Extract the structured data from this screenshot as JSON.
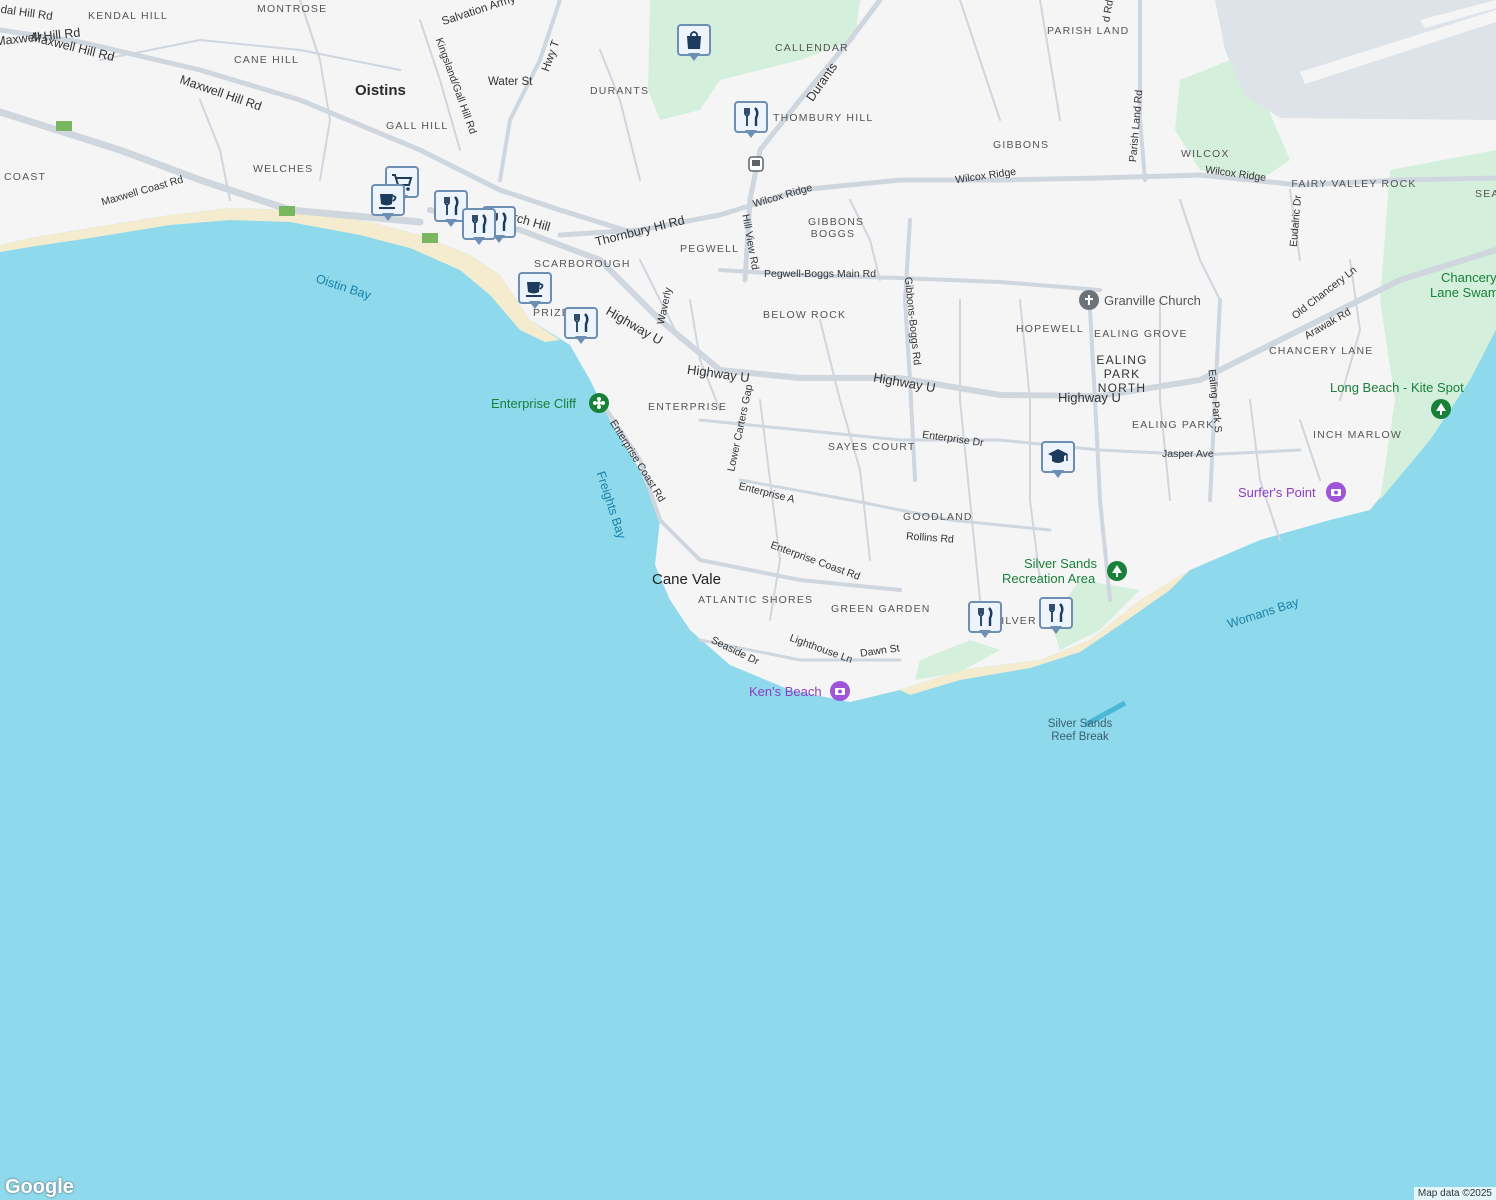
{
  "map": {
    "towns": [
      {
        "id": "oistins",
        "text": "Oistins"
      },
      {
        "id": "cane-vale",
        "text": "Cane Vale"
      }
    ],
    "areas": [
      {
        "id": "kendal-hill",
        "text": "KENDAL HILL"
      },
      {
        "id": "montrose",
        "text": "MONTROSE"
      },
      {
        "id": "cane-hill",
        "text": "CANE HILL"
      },
      {
        "id": "callendar",
        "text": "CALLENDAR"
      },
      {
        "id": "parish-land",
        "text": "PARISH LAND"
      },
      {
        "id": "durants",
        "text": "DURANTS"
      },
      {
        "id": "gall-hill",
        "text": "GALL HILL"
      },
      {
        "id": "thombury-hill",
        "text": "THOMBURY HILL"
      },
      {
        "id": "welches",
        "text": "WELCHES"
      },
      {
        "id": "coast",
        "text": "COAST"
      },
      {
        "id": "gibbons",
        "text": "GIBBONS"
      },
      {
        "id": "wilcox",
        "text": "WILCOX"
      },
      {
        "id": "fairy-valley-rock",
        "text": "FAIRY VALLEY ROCK"
      },
      {
        "id": "gibbons-boggs",
        "text": "GIBBONS BOGGS"
      },
      {
        "id": "pegwell",
        "text": "PEGWELL"
      },
      {
        "id": "scarborough",
        "text": "SCARBOROUGH"
      },
      {
        "id": "below-rock",
        "text": "BELOW ROCK"
      },
      {
        "id": "hopewell",
        "text": "HOPEWELL"
      },
      {
        "id": "ealing-grove",
        "text": "EALING GROVE"
      },
      {
        "id": "chancery-lane",
        "text": "CHANCERY LANE"
      },
      {
        "id": "ealing-park-north",
        "text": "EALING PARK NORTH"
      },
      {
        "id": "enterprise",
        "text": "ENTERPRISE"
      },
      {
        "id": "sayes-court",
        "text": "SAYES COURT"
      },
      {
        "id": "ealing-park",
        "text": "EALING PARK"
      },
      {
        "id": "inch-marlow",
        "text": "INCH MARLOW"
      },
      {
        "id": "goodland",
        "text": "GOODLAND"
      },
      {
        "id": "atlantic-shores",
        "text": "ATLANTIC SHORES"
      },
      {
        "id": "green-garden",
        "text": "GREEN GARDEN"
      },
      {
        "id": "prize",
        "text": "PRIZE"
      },
      {
        "id": "silver-sands",
        "text": "SILVER S"
      },
      {
        "id": "sea",
        "text": "SEA"
      }
    ],
    "roads": [
      {
        "id": "kendal-hill-rd",
        "text": "Kendal Hill Rd"
      },
      {
        "id": "maxwell-hill-rd-1",
        "text": "Maxwell Hill Rd"
      },
      {
        "id": "maxwell-hill-rd-2",
        "text": "Maxwell Hill Rd"
      },
      {
        "id": "maxwell-hill-rd-3",
        "text": "Maxwell Hill Rd"
      },
      {
        "id": "salvation-army-dr",
        "text": "Salvation Army Dr"
      },
      {
        "id": "kingsland-gall-hill-rd",
        "text": "Kingsland/Gall Hill Rd"
      },
      {
        "id": "hwy-t",
        "text": "Hwy T"
      },
      {
        "id": "water-st",
        "text": "Water St"
      },
      {
        "id": "durants-rd",
        "text": "Durants"
      },
      {
        "id": "maxwell-coast-rd",
        "text": "Maxwell Coast Rd"
      },
      {
        "id": "church-hill",
        "text": "Church Hill"
      },
      {
        "id": "thornbury-hl-rd",
        "text": "Thornbury Hl Rd"
      },
      {
        "id": "wilcox-ridge-1",
        "text": "Wilcox Ridge"
      },
      {
        "id": "wilcox-ridge-2",
        "text": "Wilcox Ridge"
      },
      {
        "id": "wilcox-ridge-3",
        "text": "Wilcox Ridge"
      },
      {
        "id": "hill-view-rd",
        "text": "Hill View Rd"
      },
      {
        "id": "parish-land-rd",
        "text": "Parish Land Rd"
      },
      {
        "id": "eudalric-dr",
        "text": "Eudalric Dr"
      },
      {
        "id": "pegwell-boggs-main-rd",
        "text": "Pegwell-Boggs Main Rd"
      },
      {
        "id": "gibbons-boggs-rd",
        "text": "Gibbons-Boggs Rd"
      },
      {
        "id": "waverly",
        "text": "Waverly"
      },
      {
        "id": "old-chancery-ln",
        "text": "Old Chancery Ln"
      },
      {
        "id": "arawak-rd",
        "text": "Arawak Rd"
      },
      {
        "id": "ealing-park-s",
        "text": "Ealing Park S"
      },
      {
        "id": "lower-carters-gap",
        "text": "Lower Carters Gap"
      },
      {
        "id": "enterprise-dr",
        "text": "Enterprise Dr"
      },
      {
        "id": "jasper-ave",
        "text": "Jasper Ave"
      },
      {
        "id": "enterprise-coast-rd-1",
        "text": "Enterprise Coast Rd"
      },
      {
        "id": "enterprise-coast-rd-2",
        "text": "Enterprise Coast Rd"
      },
      {
        "id": "enterprise-a",
        "text": "Enterprise A"
      },
      {
        "id": "rollins-rd",
        "text": "Rollins Rd"
      },
      {
        "id": "seaside-dr",
        "text": "Seaside Dr"
      },
      {
        "id": "lighthouse-ln",
        "text": "Lighthouse Ln"
      },
      {
        "id": "dawn-st",
        "text": "Dawn St"
      },
      {
        "id": "g-rd",
        "text": "d Rd"
      }
    ],
    "highways": [
      {
        "id": "highway-u-1",
        "text": "Highway U"
      },
      {
        "id": "highway-u-2",
        "text": "Highway U"
      },
      {
        "id": "highway-u-3",
        "text": "Highway U"
      },
      {
        "id": "highway-u-4",
        "text": "Highway U"
      }
    ],
    "water": [
      {
        "id": "oistin-bay",
        "text": "Oistin Bay"
      },
      {
        "id": "freights-bay",
        "text": "Freights Bay"
      },
      {
        "id": "womans-bay",
        "text": "Womans Bay"
      }
    ],
    "pois": [
      {
        "id": "enterprise-cliff",
        "text": "Enterprise Cliff",
        "icon": "flower-icon",
        "color": "#188038"
      },
      {
        "id": "granville-church",
        "text": "Granville Church",
        "icon": "cross-icon",
        "color": "#5f6368"
      },
      {
        "id": "long-beach-kite-spot",
        "text": "Long Beach - Kite Spot",
        "icon": "tree-icon",
        "color": "#188038"
      },
      {
        "id": "surfers-point",
        "text": "Surfer's Point",
        "icon": "camera-icon",
        "color": "#8e3cc4"
      },
      {
        "id": "silver-sands-recreation-area-1",
        "text": "Silver Sands",
        "icon": "tree-icon",
        "color": "#188038"
      },
      {
        "id": "silver-sands-recreation-area-2",
        "text": "Recreation Area",
        "icon": "",
        "color": "#188038"
      },
      {
        "id": "kens-beach",
        "text": "Ken's Beach",
        "icon": "camera-icon",
        "color": "#8e3cc4"
      },
      {
        "id": "chancery-lane-swamp-1",
        "text": "Chancery",
        "icon": "",
        "color": "#188038"
      },
      {
        "id": "chancery-lane-swamp-2",
        "text": "Lane Swam",
        "icon": "",
        "color": "#188038"
      }
    ],
    "reef": [
      "Silver Sands",
      "Reef Break"
    ],
    "markers": [
      {
        "id": "shopping-marker",
        "icon": "shopping-bag-icon"
      },
      {
        "id": "restaurant-marker-thombury",
        "icon": "fork-knife-icon"
      },
      {
        "id": "cart-marker",
        "icon": "shopping-cart-icon"
      },
      {
        "id": "cafe-marker-1",
        "icon": "coffee-cup-icon"
      },
      {
        "id": "restaurant-marker-oistins-1",
        "icon": "fork-knife-icon"
      },
      {
        "id": "restaurant-marker-oistins-2",
        "icon": "fork-knife-icon"
      },
      {
        "id": "restaurant-marker-oistins-3",
        "icon": "fork-knife-icon"
      },
      {
        "id": "cafe-marker-2",
        "icon": "coffee-cup-icon"
      },
      {
        "id": "restaurant-marker-prize",
        "icon": "fork-knife-icon"
      },
      {
        "id": "school-marker",
        "icon": "graduation-cap-icon"
      },
      {
        "id": "restaurant-marker-silver-sands-1",
        "icon": "fork-knife-icon"
      },
      {
        "id": "restaurant-marker-silver-sands-2",
        "icon": "fork-knife-icon"
      }
    ],
    "colors": {
      "sea": "#8ed9ec",
      "land": "#f5f5f6",
      "road": "#cfd6de",
      "park": "#d4f0dd",
      "sand": "#f5ecd0",
      "airport": "#dee3ea",
      "marker_border": "#6d8fb3",
      "marker_icon": "#1d3b5c"
    }
  },
  "footer": {
    "logo": "Google",
    "attribution": "Map data ©2025"
  }
}
